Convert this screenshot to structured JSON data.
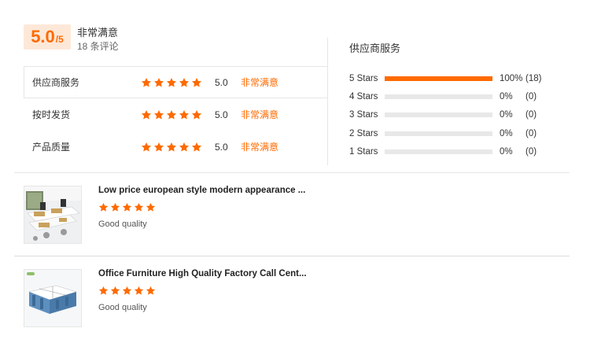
{
  "summary": {
    "score": "5.0",
    "denominator": "/5",
    "label": "非常满意",
    "review_count": "18 条评论"
  },
  "ratings": [
    {
      "label": "供应商服务",
      "stars": 5,
      "score": "5.0",
      "text": "非常满意"
    },
    {
      "label": "按时发货",
      "stars": 5,
      "score": "5.0",
      "text": "非常满意"
    },
    {
      "label": "产品质量",
      "stars": 5,
      "score": "5.0",
      "text": "非常满意"
    }
  ],
  "breakdown": {
    "title": "供应商服务",
    "rows": [
      {
        "label": "5 Stars",
        "fraction": 1.0,
        "percent": "100%",
        "count": "(18)"
      },
      {
        "label": "4 Stars",
        "fraction": 0,
        "percent": "0%",
        "count": "(0)"
      },
      {
        "label": "3 Stars",
        "fraction": 0,
        "percent": "0%",
        "count": "(0)"
      },
      {
        "label": "2 Stars",
        "fraction": 0,
        "percent": "0%",
        "count": "(0)"
      },
      {
        "label": "1 Stars",
        "fraction": 0,
        "percent": "0%",
        "count": "(0)"
      }
    ]
  },
  "reviews": [
    {
      "title": "Low price european style modern appearance ...",
      "stars": 5,
      "comment": "Good quality",
      "image": "office-desk-thumbnail"
    },
    {
      "title": "Office Furniture High Quality Factory Call Cent...",
      "stars": 5,
      "comment": "Good quality",
      "image": "cubicle-workstation-thumbnail"
    }
  ],
  "colors": {
    "accent": "#ff6a00",
    "accent_bg": "#fde8d8",
    "track": "#e8e8e8",
    "divider": "#e6e6e6"
  },
  "icons": {
    "star": "star-icon"
  }
}
